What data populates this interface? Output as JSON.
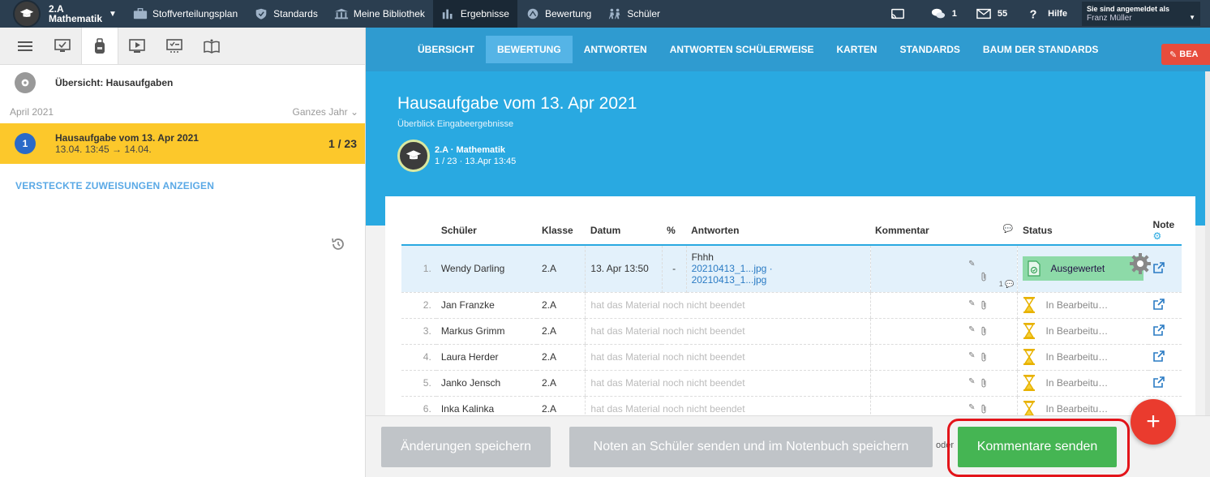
{
  "topbar": {
    "class_name_line1": "2.A",
    "class_name_line2": "Mathematik",
    "nav": [
      {
        "label": "Stoffverteilungsplan",
        "icon": "briefcase-icon"
      },
      {
        "label": "Standards",
        "icon": "shield-icon"
      },
      {
        "label": "Meine Bibliothek",
        "icon": "library-icon"
      },
      {
        "label": "Ergebnisse",
        "icon": "bar-chart-icon",
        "active": true
      },
      {
        "label": "Bewertung",
        "icon": "rating-icon"
      },
      {
        "label": "Schüler",
        "icon": "students-icon"
      }
    ],
    "messages_count": "1",
    "mail_count": "55",
    "help_label": "Hilfe",
    "logged_in_label": "Sie sind angemeldet als",
    "user_name": "Franz Müller"
  },
  "sidebar": {
    "overview_title": "Übersicht: Hausaufgaben",
    "month": "April 2021",
    "range": "Ganzes Jahr",
    "assignment": {
      "number": "1",
      "title": "Hausaufgabe vom 13. Apr 2021",
      "subtitle": "13.04. 13:45 → 14.04.",
      "count": "1 / 23"
    },
    "hidden_link": "VERSTECKTE ZUWEISUNGEN ANZEIGEN"
  },
  "main": {
    "tabs": [
      "ÜBERSICHT",
      "BEWERTUNG",
      "ANTWORTEN",
      "ANTWORTEN SCHÜLERWEISE",
      "KARTEN",
      "STANDARDS",
      "BAUM DER STANDARDS"
    ],
    "active_tab": "BEWERTUNG",
    "red_button": "BEA",
    "title": "Hausaufgabe vom 13. Apr 2021",
    "subtitle": "Überblick Eingabeergebnisse",
    "class_badge_name": "2.A · Mathematik",
    "class_badge_meta": "1 / 23 · 13.Apr 13:45"
  },
  "table": {
    "headers": {
      "student": "Schüler",
      "class": "Klasse",
      "date": "Datum",
      "percent": "%",
      "answers": "Antworten",
      "comment": "Kommentar",
      "status": "Status",
      "grade": "Note"
    },
    "rows": [
      {
        "idx": "1.",
        "name": "Wendy Darling",
        "class": "2.A",
        "date": "13. Apr 13:50",
        "percent": "-",
        "answer_text": "Fhhh",
        "answer_file1": "20210413_1...jpg ·",
        "answer_file2": "20210413_1...jpg",
        "comment_count": "1",
        "status": "Ausgewertet"
      },
      {
        "idx": "2.",
        "name": "Jan Franzke",
        "class": "2.A",
        "note": "hat das Material noch nicht beendet",
        "status": "In Bearbeitu…"
      },
      {
        "idx": "3.",
        "name": "Markus Grimm",
        "class": "2.A",
        "note": "hat das Material noch nicht beendet",
        "status": "In Bearbeitu…"
      },
      {
        "idx": "4.",
        "name": "Laura Herder",
        "class": "2.A",
        "note": "hat das Material noch nicht beendet",
        "status": "In Bearbeitu…"
      },
      {
        "idx": "5.",
        "name": "Janko Jensch",
        "class": "2.A",
        "note": "hat das Material noch nicht beendet",
        "status": "In Bearbeitu…"
      },
      {
        "idx": "6.",
        "name": "Inka Kalinka",
        "class": "2.A",
        "note": "hat das Material noch nicht beendet",
        "status": "In Bearbeitu…"
      }
    ]
  },
  "bottom": {
    "save_label": "Änderungen speichern",
    "send_grades_label": "Noten an Schüler senden und im Notenbuch speichern",
    "or_label": "oder",
    "send_comments_label": "Kommentare senden",
    "fab_label": "+"
  },
  "colors": {
    "topbar": "#2b3e50",
    "accent_blue": "#29a9e1",
    "highlight": "#fcc82b",
    "green": "#45b553",
    "red": "#ea3b2e"
  }
}
